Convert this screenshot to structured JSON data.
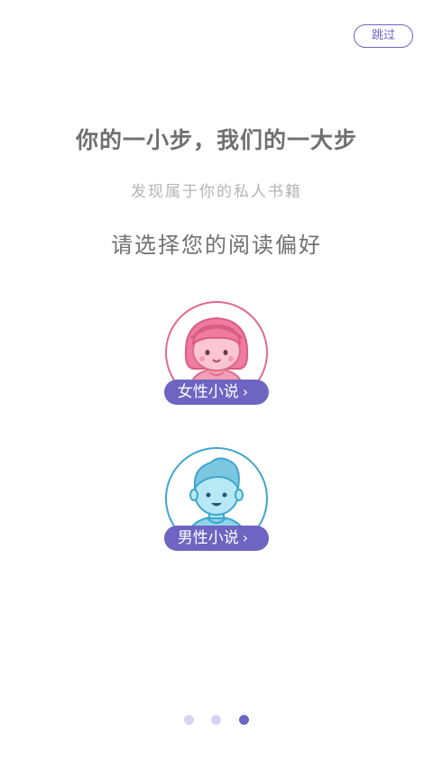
{
  "skip": {
    "label": "跳过"
  },
  "headline": "你的一小步，我们的一大步",
  "subtitle": "发现属于你的私人书籍",
  "prompt": "请选择您的阅读偏好",
  "choices": {
    "female": {
      "label": "女性小说",
      "chevron": "›",
      "accent": "#e06a8e",
      "icon": "girl-avatar-icon"
    },
    "male": {
      "label": "男性小说",
      "chevron": "›",
      "accent": "#3ea6cc",
      "icon": "boy-avatar-icon"
    }
  },
  "pager": {
    "count": 3,
    "active_index": 2
  },
  "colors": {
    "accent": "#6e64c2",
    "text": "#707070",
    "muted": "#b4b4b4"
  }
}
